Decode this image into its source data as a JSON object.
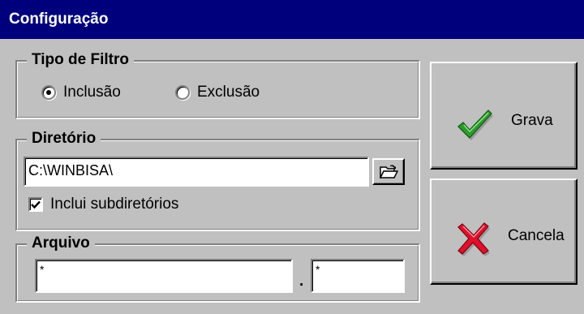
{
  "window": {
    "title": "Configuração"
  },
  "tipo_filtro": {
    "legend": "Tipo de Filtro",
    "options": [
      {
        "label": "Inclusão",
        "checked": true
      },
      {
        "label": "Exclusão",
        "checked": false
      }
    ]
  },
  "diretorio": {
    "legend": "Diretório",
    "path_value": "C:\\WINBISA\\",
    "browse_icon": "folder-open-icon",
    "include_subdirs": {
      "label": "Inclui subdiretórios",
      "checked": true
    }
  },
  "arquivo": {
    "legend": "Arquivo",
    "name_value": "*",
    "separator": ".",
    "ext_value": "*"
  },
  "buttons": {
    "grava": {
      "label": "Grava",
      "icon": "green-checkmark-icon",
      "color": "#2e9a2e"
    },
    "cancela": {
      "label": "Cancela",
      "icon": "red-x-icon",
      "color": "#e0102a"
    }
  },
  "colors": {
    "titlebar": "#00007c",
    "face": "#c0c0c0"
  }
}
